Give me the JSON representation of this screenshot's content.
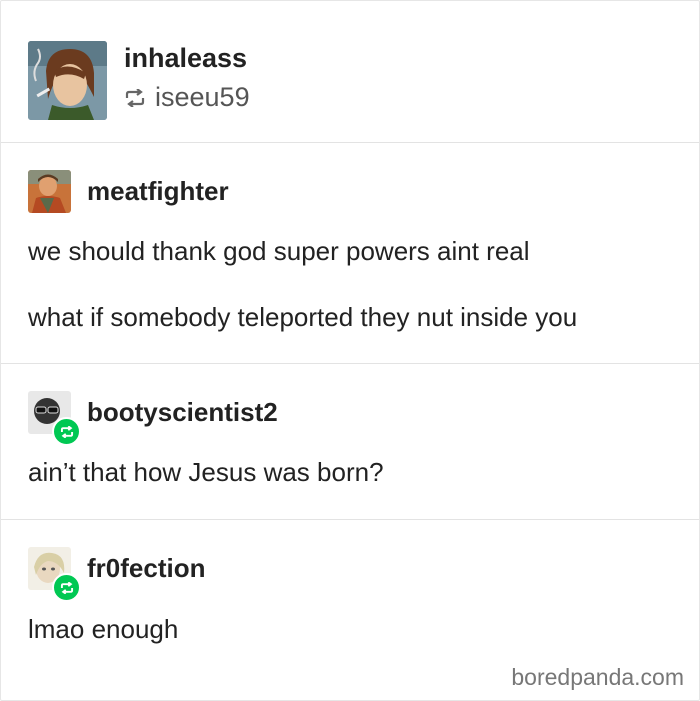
{
  "header": {
    "username": "inhaleass",
    "reblogged_from": "iseeu59",
    "reblog_icon": "reblog-icon"
  },
  "posts": [
    {
      "username": "meatfighter",
      "paragraphs": [
        "we should thank god super powers aint real",
        "what if somebody teleported they nut inside you"
      ]
    },
    {
      "username": "bootyscientist2",
      "paragraphs": [
        "ain’t that how Jesus was born?"
      ],
      "badge_icon": "reblog-badge-icon"
    },
    {
      "username": "fr0fection",
      "paragraphs": [
        "lmao enough"
      ],
      "badge_icon": "reblog-badge-icon"
    }
  ],
  "watermark": "boredpanda.com",
  "colors": {
    "badge": "#00c853",
    "divider": "#e3e3e3",
    "text": "#222222",
    "muted": "#555555"
  }
}
